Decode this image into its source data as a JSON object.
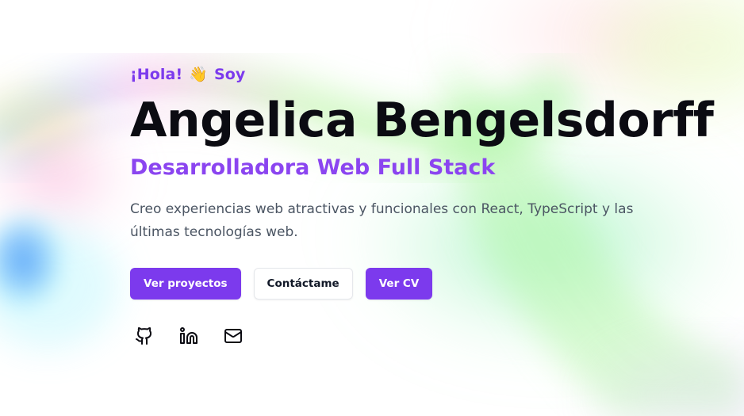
{
  "hero": {
    "greeting": "¡Hola!",
    "greeting_emoji": "👋",
    "greeting_suffix": "Soy",
    "name": "Angelica Bengelsdorff",
    "role": "Desarrolladora Web Full Stack",
    "description": "Creo experiencias web atractivas y funcionales con React, TypeScript y las últimas tecnologías web."
  },
  "actions": {
    "projects_label": "Ver proyectos",
    "contact_label": "Contáctame",
    "cv_label": "Ver CV"
  },
  "socials": [
    {
      "icon": "github-icon"
    },
    {
      "icon": "linkedin-icon"
    },
    {
      "icon": "mail-icon"
    }
  ],
  "colors": {
    "accent": "#7c3aed",
    "role_text": "#8b45f0",
    "heading": "#0b0b12",
    "body_text": "#4b5563"
  }
}
